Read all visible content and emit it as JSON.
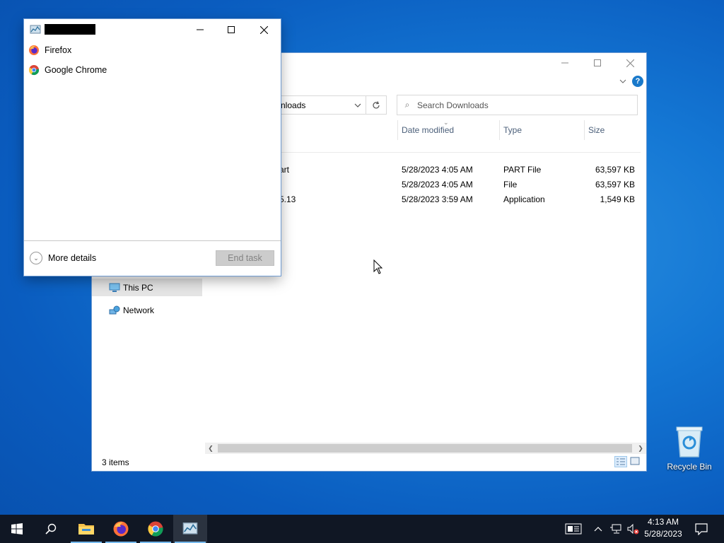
{
  "desktop": {
    "recycle_bin_label": "Recycle Bin"
  },
  "explorer": {
    "address_text": "nloads",
    "search_placeholder": "Search Downloads",
    "columns": {
      "date": "Date modified",
      "type": "Type",
      "size": "Size"
    },
    "files": [
      {
        "name": "art",
        "date": "5/28/2023 4:05 AM",
        "type": "PART File",
        "size": "63,597 KB"
      },
      {
        "name": "",
        "date": "5/28/2023 4:05 AM",
        "type": "File",
        "size": "63,597 KB"
      },
      {
        "name": "5.13",
        "date": "5/28/2023 3:59 AM",
        "type": "Application",
        "size": "1,549 KB"
      }
    ],
    "nav": {
      "this_pc": "This PC",
      "network": "Network"
    },
    "status": "3 items"
  },
  "task_manager": {
    "apps": [
      "Firefox",
      "Google Chrome"
    ],
    "more_details": "More details",
    "end_task": "End task"
  },
  "taskbar": {
    "time": "4:13 AM",
    "date": "5/28/2023"
  }
}
